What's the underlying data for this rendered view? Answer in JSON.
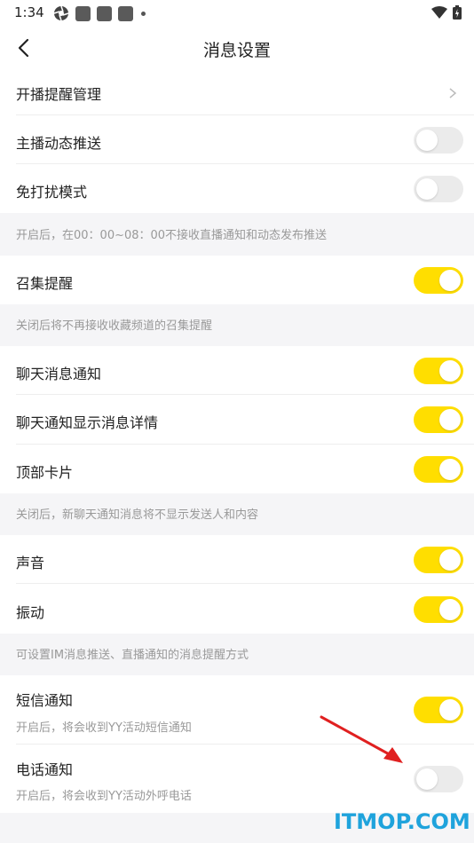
{
  "status_bar": {
    "time": "1:34"
  },
  "header": {
    "title": "消息设置"
  },
  "sections": {
    "live_reminder": {
      "label": "开播提醒管理"
    },
    "anchor_push": {
      "label": "主播动态推送",
      "on": false
    },
    "dnd": {
      "label": "免打扰模式",
      "on": false
    },
    "dnd_note": "开启后，在00：00~08：00不接收直播通知和动态发布推送",
    "gather": {
      "label": "召集提醒",
      "on": true
    },
    "gather_note": "关闭后将不再接收收藏频道的召集提醒",
    "chat_notify": {
      "label": "聊天消息通知",
      "on": true
    },
    "chat_detail": {
      "label": "聊天通知显示消息详情",
      "on": true
    },
    "top_card": {
      "label": "顶部卡片",
      "on": true
    },
    "chat_note": "关闭后，新聊天通知消息将不显示发送人和内容",
    "sound": {
      "label": "声音",
      "on": true
    },
    "vibrate": {
      "label": "振动",
      "on": true
    },
    "sound_note": "可设置IM消息推送、直播通知的消息提醒方式",
    "sms": {
      "label": "短信通知",
      "sub": "开启后，将会收到YY活动短信通知",
      "on": true
    },
    "phone": {
      "label": "电话通知",
      "sub": "开启后，将会收到YY活动外呼电话",
      "on": false
    }
  },
  "watermark": "ITMOP.COM",
  "colors": {
    "toggle_on": "#ffde00",
    "toggle_off": "#ebebeb",
    "arrow": "#e02020",
    "watermark": "#1fa3dc"
  }
}
